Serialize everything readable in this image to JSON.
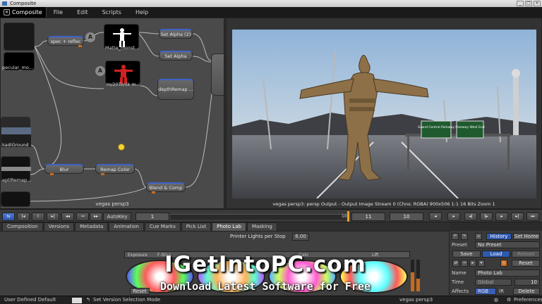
{
  "window": {
    "title": "Composite"
  },
  "menu": {
    "brand": "Composite",
    "items": [
      "File",
      "Edit",
      "Scripts",
      "Help"
    ]
  },
  "graph": {
    "caption": "vegas persp3",
    "nodes": {
      "spec_reflec": "spec + reflec",
      "matte_monst": "Matte_monst...",
      "set_alpha_2": "Set Alpha (2)",
      "set_alpha": "Set Alpha",
      "zt_onik": "m/20Tonik m...",
      "depth_remap_a": "depthRemap ...",
      "specular": "pecular_mo...",
      "background": "kadiGround",
      "depth_remap_b": "eptlRemap...",
      "blur": "Blur",
      "remap_color": "Remap Color",
      "blend_comp": "Blend & Comp"
    }
  },
  "viewer": {
    "status": "vegas persp3: persp Output - Output Image  Stream 0 (Chns: RGBA)  900x506  1:1  16 Bits  Zoom 1",
    "sign_left": "Grand Central Parkway",
    "sign_right": "Freeway West End"
  },
  "timeline": {
    "autokey": "AutoKey",
    "frame_field": "1",
    "frame_marker": "10",
    "current": "11",
    "end": "10"
  },
  "tabs": [
    "Composition",
    "Versions",
    "Metadata",
    "Animation",
    "Cue Marks",
    "Pick List",
    "Photo Lab",
    "Masking"
  ],
  "active_tab": "Photo Lab",
  "panel": {
    "printer_lights_label": "Printer Lights per Stop",
    "printer_lights_value": "6.00",
    "col_exposure": "Exposure",
    "col_fstop": "F-Stop",
    "col_gain": "Gain",
    "col_lift": "Lift",
    "reset": "Reset"
  },
  "right": {
    "history": "History",
    "set_home": "Set Home",
    "preset_label": "Preset",
    "preset_value": "No Preset",
    "save": "Save",
    "load": "Load",
    "reload": "Reload",
    "reset": "Reset",
    "name_label": "Name",
    "name_value": "Photo Lab",
    "time_label": "Time",
    "time_value": "Global",
    "time_num": "10",
    "affects_label": "Affects",
    "affects_value": "RGB",
    "ir": "IR",
    "delete": "Delete"
  },
  "status": {
    "left": "User Defined Default",
    "mid": "Set Version Selection Mode",
    "right_node": "vegas persp3",
    "prefs": "Preferences"
  },
  "watermark": {
    "big": "IGetIntoPC.com",
    "small": "Download Latest Software for Free"
  },
  "colors": {
    "accent": "#2d59b0",
    "orange": "#c86a1a",
    "panel": "#3f3f3f"
  }
}
